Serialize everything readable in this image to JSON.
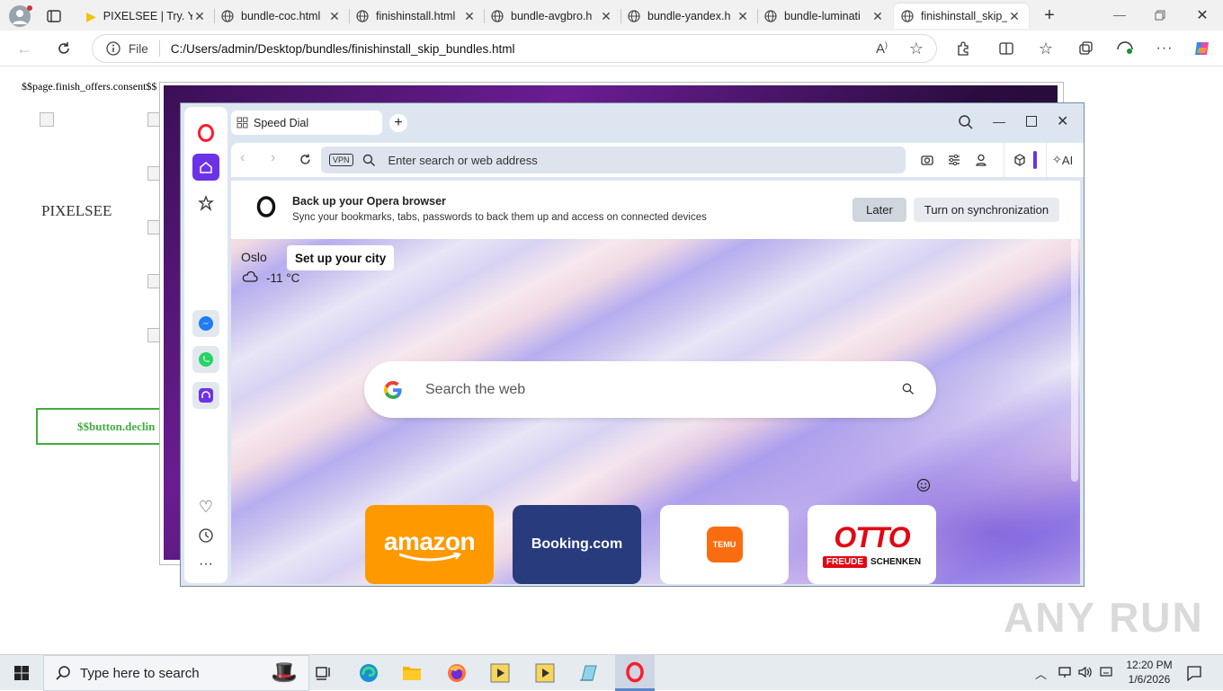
{
  "browser": {
    "tabs": [
      {
        "title": "PIXELSEE | Try. Yo",
        "active": false
      },
      {
        "title": "bundle-coc.html",
        "active": false
      },
      {
        "title": "finishinstall.html",
        "active": false
      },
      {
        "title": "bundle-avgbro.h",
        "active": false
      },
      {
        "title": "bundle-yandex.h",
        "active": false
      },
      {
        "title": "bundle-luminati",
        "active": false
      },
      {
        "title": "finishinstall_skip_",
        "active": true
      }
    ],
    "address": {
      "scheme_label": "File",
      "url": "C:/Users/admin/Desktop/bundles/finishinstall_skip_bundles.html"
    }
  },
  "page": {
    "consent_text": "$$page.finish_offers.consent$$",
    "brand_text": "PIXELSEE",
    "decline_button": "$$button.declin"
  },
  "opera": {
    "tab_title": "Speed Dial",
    "vpn_label": "VPN",
    "search_placeholder": "Enter search or web address",
    "ai_label": "AI",
    "sync": {
      "title": "Back up your Opera browser",
      "subtitle": "Sync your bookmarks, tabs, passwords to back them up and access on connected devices",
      "later": "Later",
      "turn_on": "Turn on synchronization"
    },
    "weather": {
      "city": "Oslo",
      "setup": "Set up your city",
      "temp": "-11 °C"
    },
    "web_search_placeholder": "Search the web",
    "speed_dial": [
      {
        "name": "amazon",
        "bg": "#ff9900"
      },
      {
        "name": "Booking.com",
        "bg": "#273b7d"
      },
      {
        "name": "TEMU",
        "bg": "#ffffff"
      },
      {
        "name": "OTTO",
        "bg": "#ffffff",
        "tag1": "FREUDE",
        "tag2": "SCHENKEN"
      }
    ]
  },
  "watermark": "ANY RUN",
  "taskbar": {
    "search_placeholder": "Type here to search",
    "time": "12:20 PM",
    "date": "1/6/2026"
  }
}
